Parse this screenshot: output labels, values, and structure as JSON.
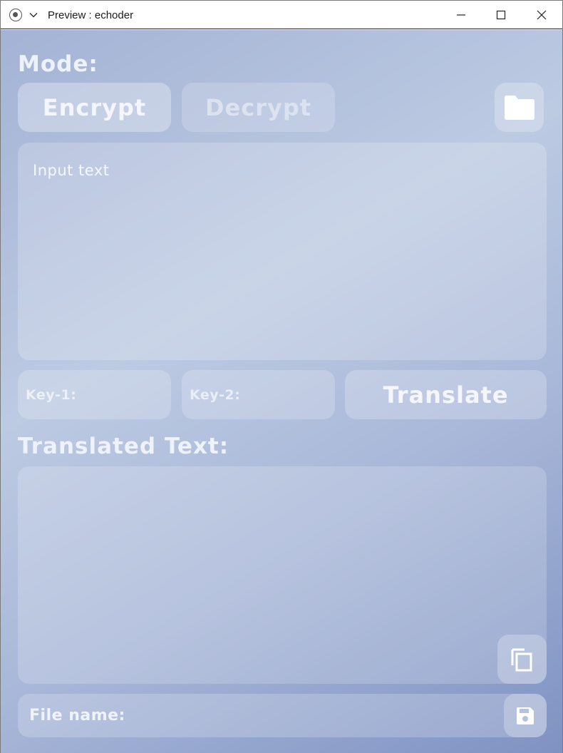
{
  "window": {
    "title": "Preview : echoder"
  },
  "mode": {
    "label": "Mode:",
    "encrypt_label": "Encrypt",
    "decrypt_label": "Decrypt",
    "selected": "Encrypt"
  },
  "input": {
    "placeholder": "Input text"
  },
  "keys": {
    "key1_label": "Key-1:",
    "key2_label": "Key-2:"
  },
  "actions": {
    "translate_label": "Translate"
  },
  "output": {
    "label": "Translated Text:"
  },
  "file": {
    "name_label": "File name:"
  },
  "icons": {
    "app": "app-icon",
    "menu": "chevron-down-icon",
    "minimize": "minimize-icon",
    "maximize": "maximize-icon",
    "close": "close-icon",
    "folder": "folder-icon",
    "copy": "copy-icon",
    "save": "save-icon"
  }
}
